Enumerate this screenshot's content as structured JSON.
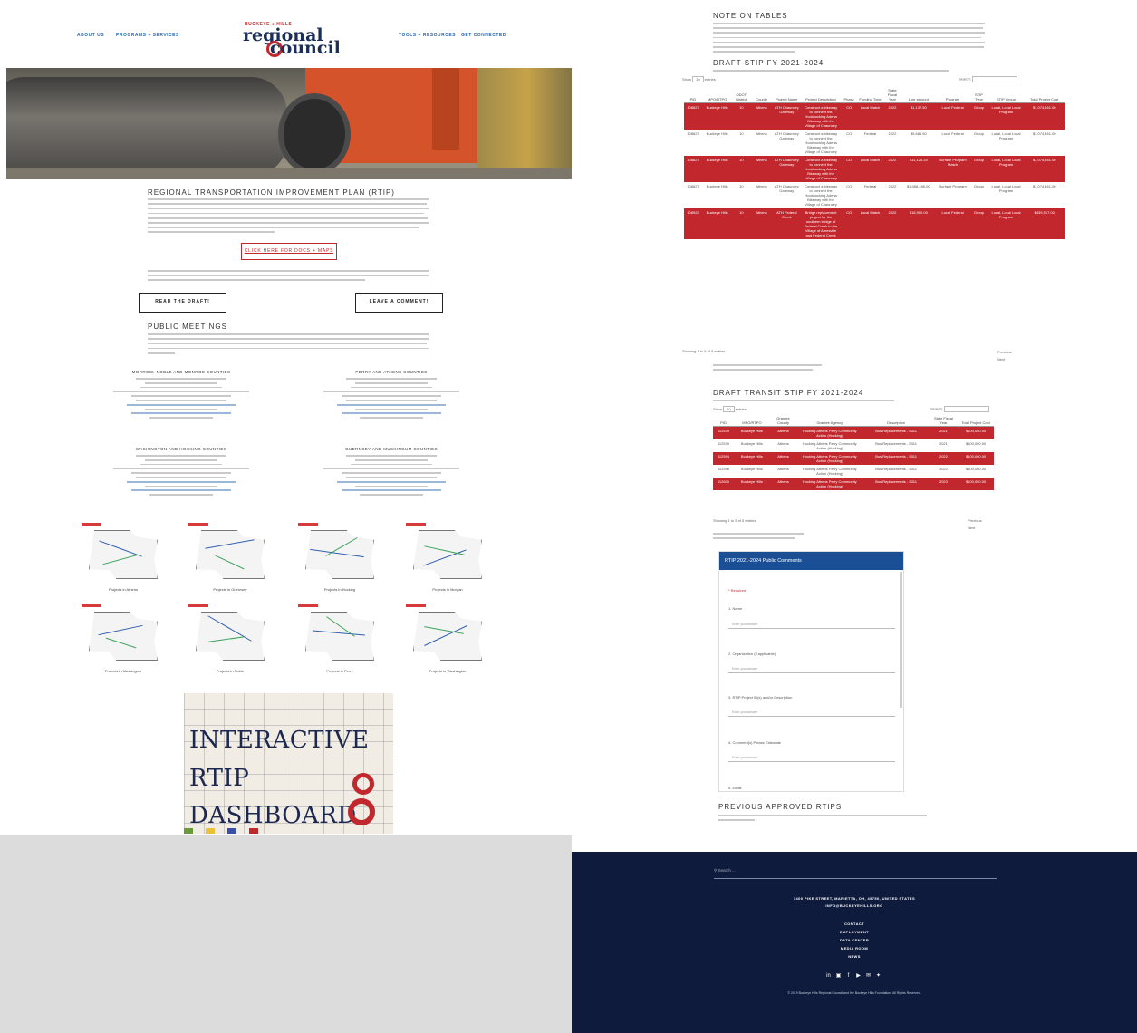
{
  "nav": {
    "left": [
      "ABOUT US",
      "PROGRAMS + SERVICES"
    ],
    "right": [
      "TOOLS + RESOURCES",
      "GET CONNECTED"
    ]
  },
  "logo": {
    "super": "BUCKEYE ● HILLS",
    "line1": "regional",
    "line2": "council"
  },
  "rtip": {
    "title": "REGIONAL TRANSPORTATION IMPROVEMENT PLAN (RTIP)",
    "cta": "CLICK HERE FOR DOCS + MAPS",
    "read_draft": "READ THE DRAFT!",
    "leave_comment": "LEAVE A COMMENT!"
  },
  "meetings": {
    "title": "PUBLIC MEETINGS",
    "items": [
      {
        "name": "MORROW, NOBLE AND MONROE COUNTIES"
      },
      {
        "name": "PERRY AND ATHENS COUNTIES"
      },
      {
        "name": "WASHINGTON AND HOCKING COUNTIES"
      },
      {
        "name": "GUERNSEY AND MUSKINGUM COUNTIES"
      }
    ]
  },
  "maps": [
    {
      "caption": "Projects in Athens"
    },
    {
      "caption": "Projects in Guernsey"
    },
    {
      "caption": "Projects in Hocking"
    },
    {
      "caption": "Projects in Morgan"
    },
    {
      "caption": "Projects in Muskingum"
    },
    {
      "caption": "Projects in Noble"
    },
    {
      "caption": "Projects in Perry"
    },
    {
      "caption": "Projects in Washington"
    }
  ],
  "dashboard": {
    "lines": [
      "INTERACTIVE",
      "RTIP",
      "DASHBOARD"
    ]
  },
  "notes": {
    "title": "NOTE ON TABLES"
  },
  "stip": {
    "title": "DRAFT STIP FY 2021-2024",
    "show_label": "Show",
    "entries_label": "entries",
    "show_value": "10",
    "search_label": "Search:",
    "headers": [
      "PID",
      "MPO/RTPO",
      "ODOT District",
      "County",
      "Project Name",
      "Project Description",
      "Phase",
      "Funding Type",
      "State Fiscal Year",
      "Line amount",
      "Program",
      "STIP Type",
      "STIP Group",
      "Total Project Cost"
    ],
    "rows": [
      {
        "red": true,
        "cells": [
          "108827",
          "Buckeye Hills",
          "10",
          "Athens",
          "ATH Chauncey Gateway",
          "Construct a bikeway to connect the Hockhocking Adena Bikeway with the Village of Chauncey",
          "CO",
          "Local Match",
          "2022",
          "$1,137.50",
          "Local Federal",
          "Group",
          "Local, Local Local Program",
          "$1,074,461.00"
        ]
      },
      {
        "red": false,
        "cells": [
          "108827",
          "Buckeye Hills",
          "10",
          "Athens",
          "ATH Chauncey Gateway",
          "Construct a bikeway to connect the Hockhocking Adena Bikeway with the Village of Chauncey",
          "CO",
          "Federal",
          "2022",
          "$5,686.50",
          "Local Federal",
          "Group",
          "Local, Local Local Program",
          "$1,074,461.00"
        ]
      },
      {
        "red": true,
        "cells": [
          "108827",
          "Buckeye Hills",
          "10",
          "Athens",
          "ATH Chauncey Gateway",
          "Construct a bikeway to connect the Hockhocking Adena Bikeway with the Village of Chauncey",
          "CO",
          "Local Match",
          "2022",
          "$11,125.25",
          "Surface Program Match",
          "Group",
          "Local, Local Local Program",
          "$1,074,461.00"
        ]
      },
      {
        "red": false,
        "cells": [
          "108827",
          "Buckeye Hills",
          "10",
          "Athens",
          "ATH Chauncey Gateway",
          "Construct a bikeway to connect the Hockhocking Adena Bikeway with the Village of Chauncey",
          "CO",
          "Federal",
          "2022",
          "$1,068,496.00",
          "Surface Program",
          "Group",
          "Local, Local Local Program",
          "$1,074,461.00"
        ]
      },
      {
        "red": true,
        "cells": [
          "108922",
          "Buckeye Hills",
          "10",
          "Athens",
          "ATH Federal Creek",
          "Bridge replacement project for the southern bridge of Federal Creek in the Village of Amesville and Federal Creek",
          "CO",
          "Local Match",
          "2022",
          "$18,950.00",
          "Local Federal",
          "Group",
          "Local, Local Local Program",
          "$439,517.00"
        ]
      }
    ],
    "info": "Showing 1 to 5 of 5 entries",
    "prev": "Previous",
    "next": "Next"
  },
  "transit": {
    "title": "DRAFT TRANSIT STIP FY 2021-2024",
    "show_label": "Show",
    "entries_label": "entries",
    "show_value": "10",
    "search_label": "Search:",
    "headers": [
      "PID",
      "MPO/RTPO",
      "Grantee County",
      "Grantee Agency",
      "Description",
      "State Fiscal Year",
      "Total Project Cost"
    ],
    "rows": [
      {
        "red": true,
        "cells": [
          "112579",
          "Buckeye Hills",
          "Athens",
          "Hocking Athens Perry Community Action (Hocking)",
          "Bus Replacements - 5311",
          "2021",
          "$100,000.00"
        ]
      },
      {
        "red": false,
        "cells": [
          "112579",
          "Buckeye Hills",
          "Athens",
          "Hocking Athens Perry Community Action (Hocking)",
          "Bus Replacements - 5311",
          "2021",
          "$100,000.00"
        ]
      },
      {
        "red": true,
        "cells": [
          "112594",
          "Buckeye Hills",
          "Athens",
          "Hocking Athens Perry Community Action (Hocking)",
          "Bus Replacements - 5311",
          "2022",
          "$100,000.00"
        ]
      },
      {
        "red": false,
        "cells": [
          "112596",
          "Buckeye Hills",
          "Athens",
          "Hocking Athens Perry Community Action (Hocking)",
          "Bus Replacements - 5311",
          "2022",
          "$100,000.00"
        ]
      },
      {
        "red": true,
        "cells": [
          "112600",
          "Buckeye Hills",
          "Athens",
          "Hocking Athens Perry Community Action (Hocking)",
          "Bus Replacements - 5311",
          "2023",
          "$100,000.00"
        ]
      }
    ],
    "info": "Showing 1 to 5 of 5 entries",
    "prev": "Previous",
    "next": "Next"
  },
  "form": {
    "title": "RTIP 2021-2024 Public Comments",
    "required": "* Required",
    "fields": [
      {
        "label": "1. Name",
        "placeholder": "Enter your answer"
      },
      {
        "label": "2. Organization (if applicable)",
        "placeholder": "Enter your answer"
      },
      {
        "label": "3. RTIP Project ID(s) and/or Description",
        "placeholder": "Enter your answer"
      },
      {
        "label": "4. Comment(s) Please Elaborate",
        "placeholder": "Enter your answer"
      },
      {
        "label": "5. Email",
        "placeholder": ""
      }
    ]
  },
  "previous": {
    "title": "PREVIOUS APPROVED RTIPS"
  },
  "footer": {
    "search_placeholder": "Search ...",
    "address": "1400 PIKE STREET, MARIETTA, OH, 45750, UNITED STATES",
    "email": "INFO@BUCKEYEHILLS.ORG",
    "links": [
      "CONTACT",
      "EMPLOYMENT",
      "DATA CENTER",
      "MEDIA ROOM",
      "NEWS"
    ],
    "social": [
      "in",
      "▣",
      "f",
      "▶",
      "✉",
      "✦"
    ],
    "copyright": "© 2019 Buckeye Hills Regional Council and the Buckeye Hills Foundation. All Rights Reserved."
  },
  "colors": {
    "brand_red": "#c1272d",
    "brand_navy": "#0e1b3d",
    "link_blue": "#2a6db4"
  }
}
